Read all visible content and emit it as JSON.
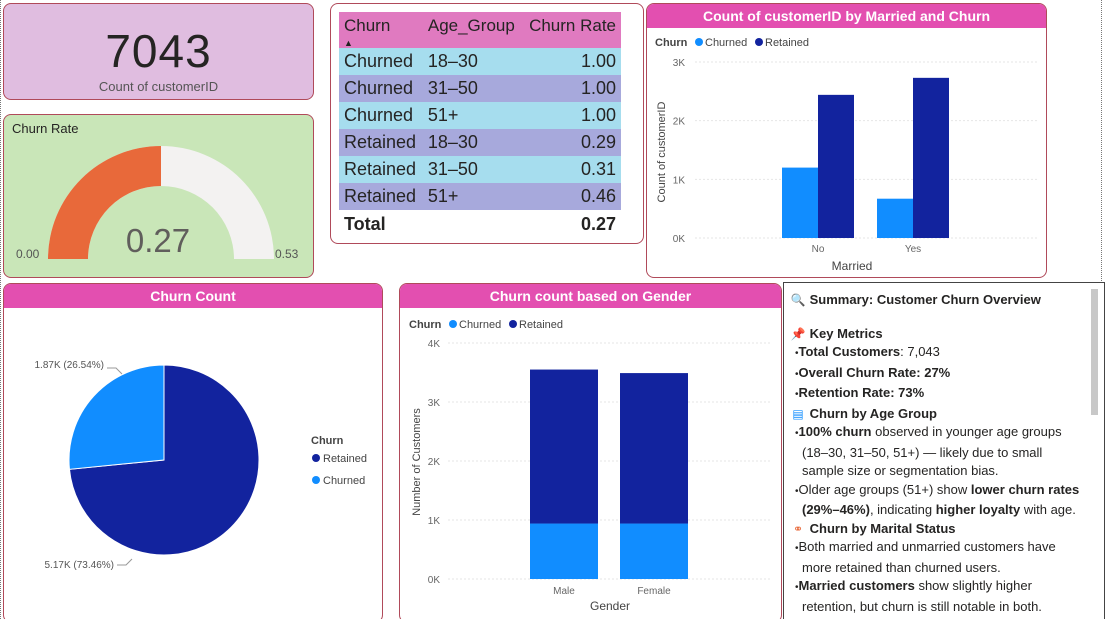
{
  "kpi": {
    "value": "7043",
    "label": "Count of customerID"
  },
  "gauge": {
    "title": "Churn Rate",
    "value": "0.27",
    "min": "0.00",
    "max": "0.53",
    "fraction": 0.5,
    "fill_color": "#e8693a",
    "track_color": "#f3f2f1"
  },
  "table": {
    "headers": [
      "Churn",
      "Age_Group",
      "Churn Rate"
    ],
    "rows": [
      [
        "Churned",
        "18–30",
        "1.00"
      ],
      [
        "Churned",
        "31–50",
        "1.00"
      ],
      [
        "Churned",
        "51+",
        "1.00"
      ],
      [
        "Retained",
        "18–30",
        "0.29"
      ],
      [
        "Retained",
        "31–50",
        "0.31"
      ],
      [
        "Retained",
        "51+",
        "0.46"
      ]
    ],
    "total_label": "Total",
    "total_value": "0.27"
  },
  "married_chart": {
    "title": "Count of customerID by Married and Churn",
    "legend_title": "Churn",
    "legend": [
      "Churned",
      "Retained"
    ],
    "colors": [
      "#118dff",
      "#12239e"
    ],
    "xlabel": "Married",
    "ylabel": "Count of customerID",
    "yticks": [
      "0K",
      "1K",
      "2K",
      "3K"
    ],
    "categories": [
      "No",
      "Yes"
    ]
  },
  "pie_chart": {
    "title": "Churn Count",
    "legend_title": "Churn",
    "legend": [
      "Retained",
      "Churned"
    ],
    "colors": [
      "#12239e",
      "#118dff"
    ],
    "label_churned": "1.87K (26.54%)",
    "label_retained": "5.17K (73.46%)"
  },
  "gender_chart": {
    "title": "Churn count based on Gender",
    "legend_title": "Churn",
    "legend": [
      "Churned",
      "Retained"
    ],
    "colors": [
      "#118dff",
      "#12239e"
    ],
    "xlabel": "Gender",
    "ylabel": "Number of Customers",
    "yticks": [
      "0K",
      "1K",
      "2K",
      "3K",
      "4K"
    ],
    "categories": [
      "Male",
      "Female"
    ]
  },
  "chart_data": [
    {
      "type": "bar",
      "title": "Count of customerID by Married and Churn",
      "xlabel": "Married",
      "ylabel": "Count of customerID",
      "categories": [
        "No",
        "Yes"
      ],
      "series": [
        {
          "name": "Churned",
          "values": [
            1200,
            670
          ]
        },
        {
          "name": "Retained",
          "values": [
            2440,
            2730
          ]
        }
      ],
      "ylim": [
        0,
        3000
      ]
    },
    {
      "type": "pie",
      "title": "Churn Count",
      "categories": [
        "Retained",
        "Churned"
      ],
      "values": [
        5170,
        1870
      ],
      "percent": [
        73.46,
        26.54
      ]
    },
    {
      "type": "bar",
      "title": "Churn count based on Gender",
      "xlabel": "Gender",
      "ylabel": "Number of Customers",
      "stacked": true,
      "categories": [
        "Male",
        "Female"
      ],
      "series": [
        {
          "name": "Churned",
          "values": [
            940,
            940
          ]
        },
        {
          "name": "Retained",
          "values": [
            2610,
            2550
          ]
        }
      ],
      "ylim": [
        0,
        4000
      ]
    }
  ],
  "summary": {
    "title": "Summary: Customer Churn Overview",
    "key_metrics": "Key Metrics",
    "m1_label": "Total Customers",
    "m1_value": ": 7,043",
    "m2_label": "Overall Churn Rate: 27%",
    "m3_label": "Retention Rate: 73%",
    "age_title": "Churn by Age Group",
    "age_b1_bold": "100% churn",
    "age_b1_text": " observed in younger age groups (18–30, 31–50, 51+) — likely due to small sample size or segmentation bias.",
    "age_b2_a": "Older age groups (51+) show ",
    "age_b2_bold1": "lower churn rates (29%–46%)",
    "age_b2_b": ", indicating ",
    "age_b2_bold2": "higher loyalty",
    "age_b2_c": " with age.",
    "marital_title": "Churn by Marital Status",
    "mar_b1": "Both married and unmarried customers have more retained than churned users.",
    "mar_b2_bold": "Married customers",
    "mar_b2_text": " show slightly higher retention, but churn is still notable in both."
  }
}
